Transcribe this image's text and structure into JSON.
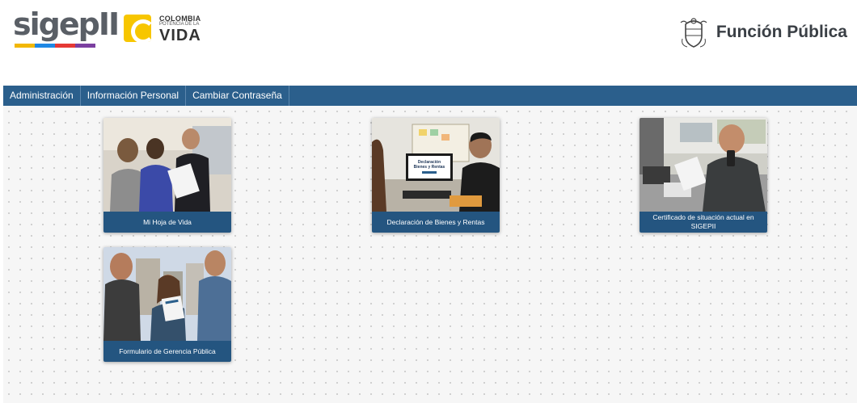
{
  "header": {
    "brand_left": "sigepII",
    "colombia": {
      "line1": "COLOMBIA",
      "line2": "POTENCIA DE LA",
      "line3": "VIDA"
    },
    "brand_right": "Función Pública",
    "stripe_colors": [
      "#f2b705",
      "#1e88e5",
      "#e53935",
      "#7b3fa0"
    ]
  },
  "nav": {
    "items": [
      {
        "label": "Administración"
      },
      {
        "label": "Información Personal"
      },
      {
        "label": "Cambiar Contraseña"
      }
    ]
  },
  "cards": [
    {
      "label": "Mi Hoja de Vida",
      "icon": "people-reviewing-document-photo"
    },
    {
      "label": "Declaración de Bienes y Rentas",
      "icon": "person-at-computer-photo",
      "screen_text": "Declaración Bienes y Rentas"
    },
    {
      "label": "Certificado de situación actual en SIGEPII",
      "icon": "man-on-phone-photo"
    },
    {
      "label": "Formulario de Gerencia Pública",
      "icon": "three-people-with-sign-photo"
    }
  ],
  "colors": {
    "nav_bg": "#2b5f8c",
    "caption_bg": "#245580",
    "page_bg": "#f6f6f6"
  }
}
